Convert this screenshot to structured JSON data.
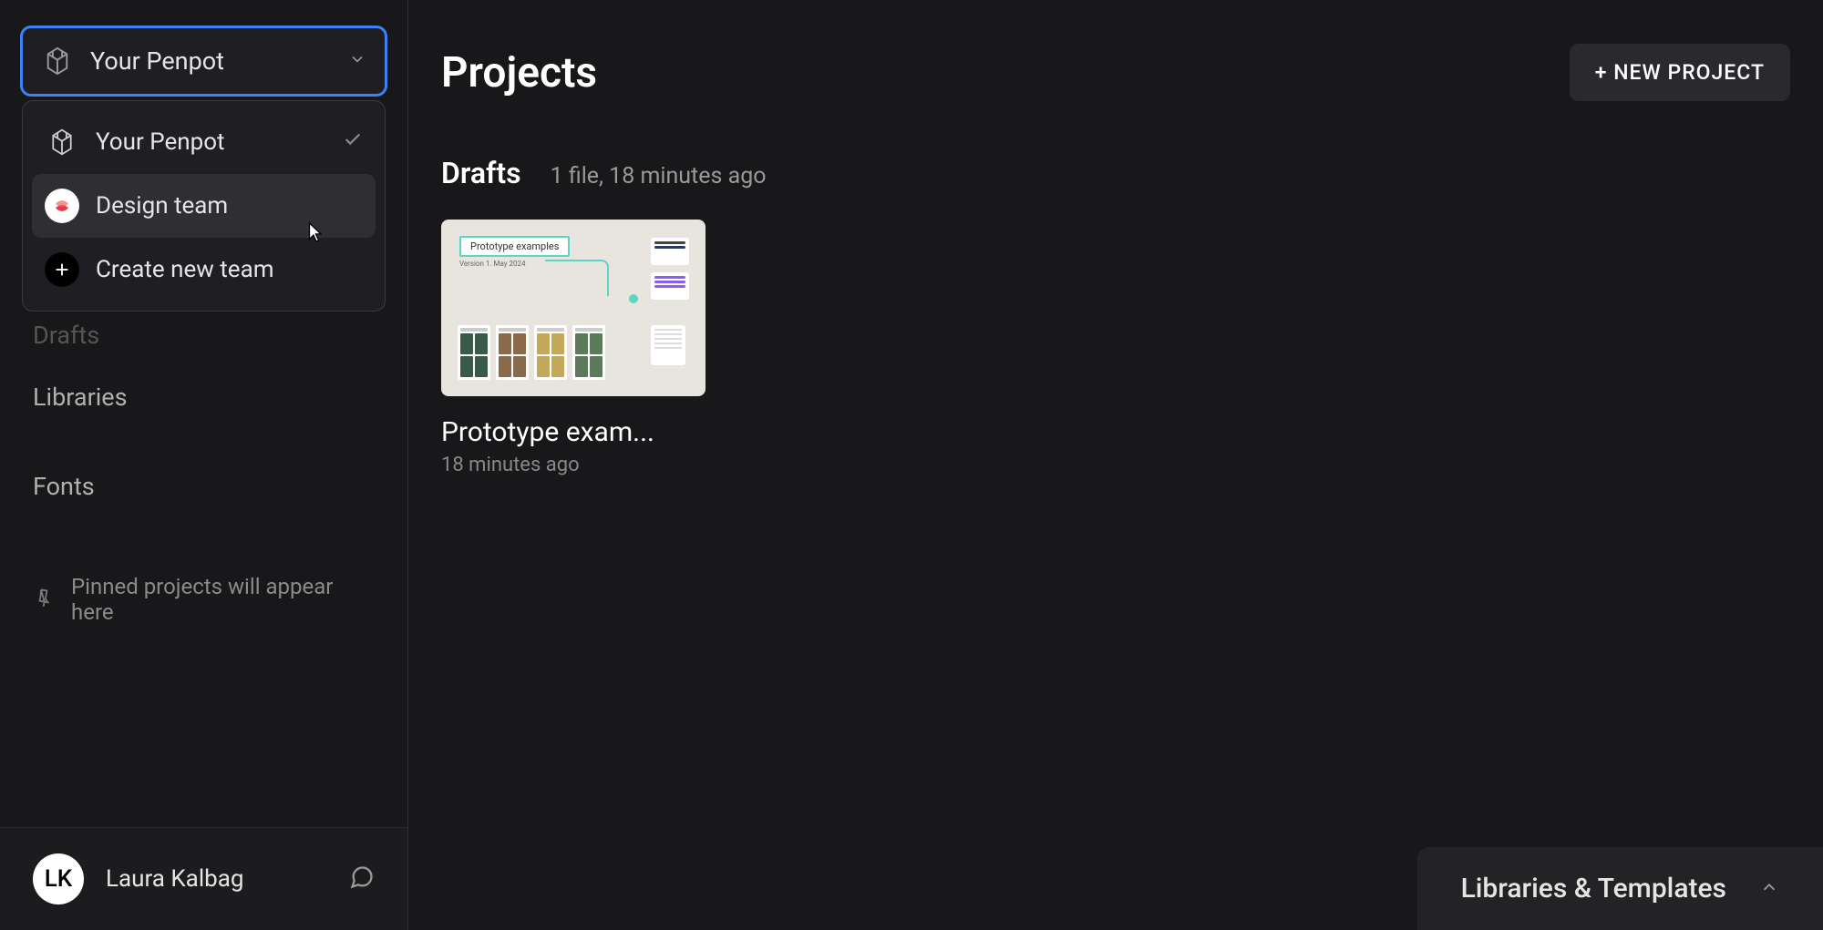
{
  "sidebar": {
    "team_selector": {
      "label": "Your Penpot"
    },
    "dropdown": {
      "items": [
        {
          "label": "Your Penpot",
          "selected": true,
          "type": "penpot"
        },
        {
          "label": "Design team",
          "selected": false,
          "type": "team"
        },
        {
          "label": "Create new team",
          "selected": false,
          "type": "create"
        }
      ]
    },
    "nav": {
      "drafts": "Drafts",
      "libraries": "Libraries",
      "fonts": "Fonts"
    },
    "pinned_hint": "Pinned projects will appear here",
    "user": {
      "initials": "LK",
      "name": "Laura Kalbag"
    }
  },
  "main": {
    "title": "Projects",
    "new_project_button": "+ NEW PROJECT",
    "section": {
      "title": "Drafts",
      "meta": "1 file, 18 minutes ago"
    },
    "files": [
      {
        "name": "Prototype exam...",
        "time": "18 minutes ago",
        "thumb_label": "Prototype examples",
        "thumb_version": "Version 1. May 2024"
      }
    ],
    "bottom_panel": "Libraries & Templates"
  }
}
